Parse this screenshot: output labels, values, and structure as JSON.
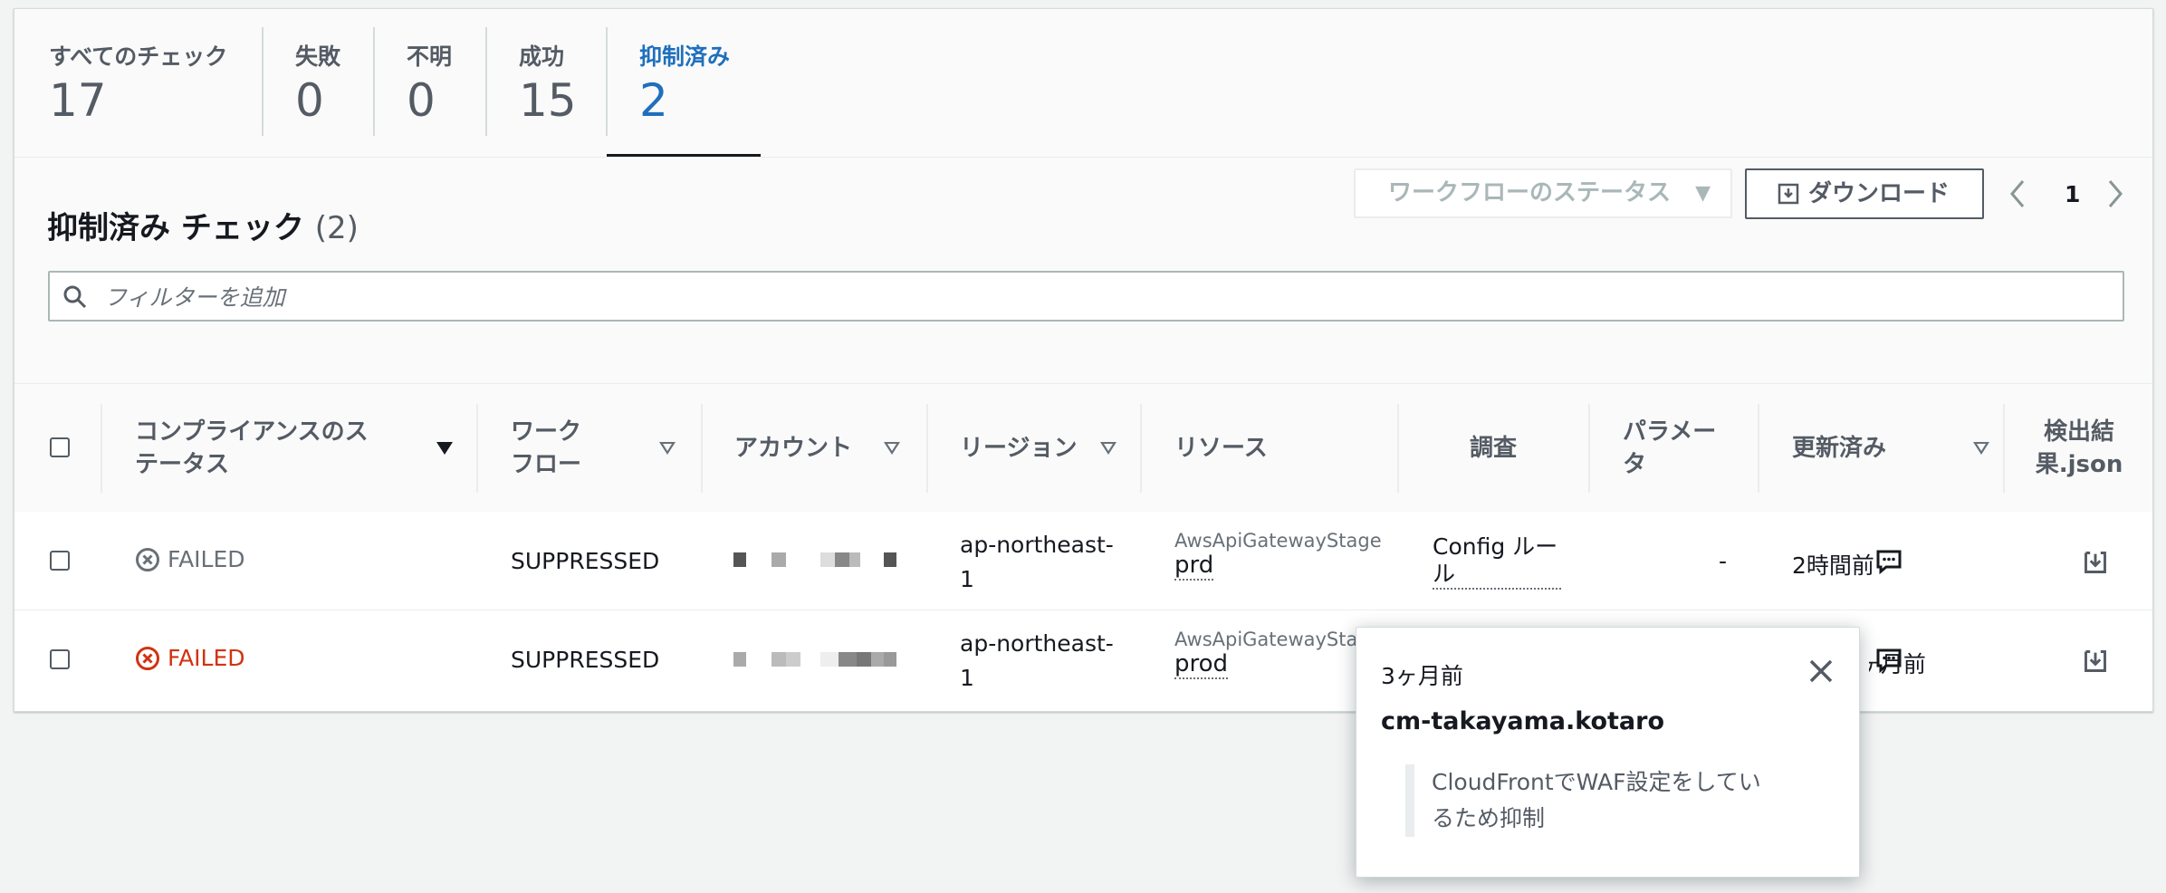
{
  "stats": [
    {
      "label": "すべてのチェック",
      "value": "17"
    },
    {
      "label": "失敗",
      "value": "0"
    },
    {
      "label": "不明",
      "value": "0"
    },
    {
      "label": "成功",
      "value": "15"
    },
    {
      "label": "抑制済み",
      "value": "2"
    }
  ],
  "section": {
    "title": "抑制済み チェック",
    "count": "(2)",
    "workflow_select": "ワークフローのステータス",
    "download_label": "ダウンロード",
    "page_number": "1",
    "filter_placeholder": "フィルターを追加"
  },
  "columns": {
    "status": "コンプライアンスのステータス",
    "workflow": "ワークフロー",
    "account": "アカウント",
    "region": "リージョン",
    "resource": "リソース",
    "investigation": "調査",
    "parameters": "パラメータ",
    "updated": "更新済み",
    "json": "検出結果.json"
  },
  "rows": [
    {
      "status": "FAILED",
      "workflow": "SUPPRESSED",
      "region": "ap-northeast-1",
      "resource_type": "AwsApiGatewayStage",
      "resource_name": "prd",
      "investigation": "Config ルール",
      "parameters": "-",
      "updated": "2時間前"
    },
    {
      "status": "FAILED",
      "workflow": "SUPPRESSED",
      "region": "ap-northeast-1",
      "resource_type": "AwsApiGatewayStage",
      "resource_name": "prod",
      "updated": "3ヶ月前"
    }
  ],
  "popover": {
    "date": "3ヶ月前",
    "user": "cm-takayama.kotaro",
    "note": "CloudFrontでWAF設定をしているため抑制"
  },
  "colors": {
    "accent": "#1f6fbd",
    "failed_red": "#d13212",
    "text_gray": "#545b64"
  }
}
